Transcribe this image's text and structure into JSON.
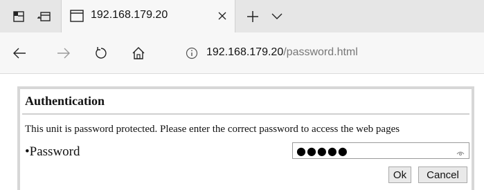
{
  "tab": {
    "title": "192.168.179.20"
  },
  "addressbar": {
    "host": "192.168.179.20",
    "path": "/password.html"
  },
  "panel": {
    "title": "Authentication",
    "description": "This unit is password protected. Please enter the correct password to access the web pages",
    "password_label": "•Password",
    "password_value": "●●●●●",
    "ok_label": "Ok",
    "cancel_label": "Cancel"
  },
  "icons": {
    "tabs_aside": "tab-actions-icon",
    "back_tabs": "set-aside-tabs-icon",
    "tab_favicon": "page-icon",
    "tab_close": "close-icon",
    "new_tab": "plus-icon",
    "tab_menu": "chevron-down-icon",
    "back": "back-arrow-icon",
    "forward": "forward-arrow-icon",
    "refresh": "refresh-icon",
    "home": "home-icon",
    "site_info": "info-icon",
    "reveal_password": "eye-icon"
  },
  "colors": {
    "tabstrip_bg": "#e6e6e6",
    "toolbar_bg": "#f7f7f7",
    "panel_border": "#d7d7d7",
    "button_bg": "#e9e9e9"
  }
}
